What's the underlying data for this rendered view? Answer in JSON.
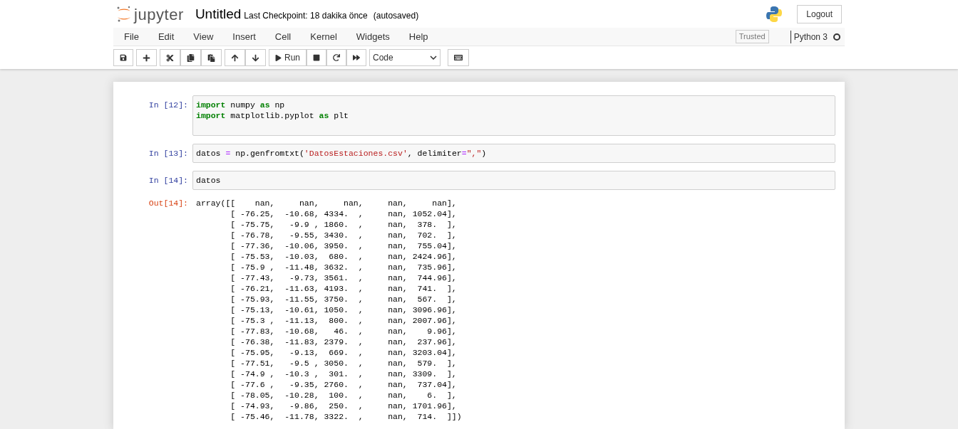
{
  "header": {
    "logo_text": "jupyter",
    "notebook_title": "Untitled",
    "checkpoint": "Last Checkpoint: 18 dakika önce",
    "autosave": "(autosaved)",
    "logout": "Logout"
  },
  "menu": [
    "File",
    "Edit",
    "View",
    "Insert",
    "Cell",
    "Kernel",
    "Widgets",
    "Help"
  ],
  "trusted": "Trusted",
  "kernel": {
    "name": "Python 3",
    "busy": false
  },
  "toolbar": {
    "run_label": "Run",
    "cell_type": "Code"
  },
  "cells": [
    {
      "prompt": "In [12]:",
      "kind": "input",
      "lines": [
        [
          {
            "text": "import",
            "kind": "keyword"
          },
          {
            "text": " numpy ",
            "kind": "name"
          },
          {
            "text": "as",
            "kind": "keyword"
          },
          {
            "text": " np",
            "kind": "name"
          }
        ],
        [
          {
            "text": "import",
            "kind": "keyword"
          },
          {
            "text": " matplotlib.pyplot ",
            "kind": "name"
          },
          {
            "text": "as",
            "kind": "keyword"
          },
          {
            "text": " plt",
            "kind": "name"
          }
        ]
      ]
    },
    {
      "prompt": "In [13]:",
      "kind": "input",
      "lines": [
        [
          {
            "text": "datos ",
            "kind": "name"
          },
          {
            "text": "=",
            "kind": "operator"
          },
          {
            "text": " np.genfromtxt(",
            "kind": "name"
          },
          {
            "text": "'DatosEstaciones.csv'",
            "kind": "string"
          },
          {
            "text": ", delimiter",
            "kind": "name"
          },
          {
            "text": "=",
            "kind": "operator"
          },
          {
            "text": "\",\"",
            "kind": "string"
          },
          {
            "text": ")",
            "kind": "name"
          }
        ]
      ]
    },
    {
      "prompt": "In [14]:",
      "kind": "input",
      "lines": [
        [
          {
            "text": "datos",
            "kind": "name"
          }
        ]
      ]
    },
    {
      "prompt": "Out[14]:",
      "kind": "output",
      "output_lines": [
        "array([[    nan,     nan,     nan,     nan,     nan],",
        "       [ -76.25,  -10.68, 4334.  ,     nan, 1052.04],",
        "       [ -75.75,   -9.9 , 1860.  ,     nan,  378.  ],",
        "       [ -76.78,   -9.55, 3430.  ,     nan,  702.  ],",
        "       [ -77.36,  -10.06, 3950.  ,     nan,  755.04],",
        "       [ -75.53,  -10.03,  680.  ,     nan, 2424.96],",
        "       [ -75.9 ,  -11.48, 3632.  ,     nan,  735.96],",
        "       [ -77.43,   -9.73, 3561.  ,     nan,  744.96],",
        "       [ -76.21,  -11.63, 4193.  ,     nan,  741.  ],",
        "       [ -75.93,  -11.55, 3750.  ,     nan,  567.  ],",
        "       [ -75.13,  -10.61, 1050.  ,     nan, 3096.96],",
        "       [ -75.3 ,  -11.13,  800.  ,     nan, 2007.96],",
        "       [ -77.83,  -10.68,   46.  ,     nan,    9.96],",
        "       [ -76.38,  -11.83, 2379.  ,     nan,  237.96],",
        "       [ -75.95,   -9.13,  669.  ,     nan, 3203.04],",
        "       [ -77.51,   -9.5 , 3050.  ,     nan,  579.  ],",
        "       [ -74.9 ,  -10.3 ,  301.  ,     nan, 3309.  ],",
        "       [ -77.6 ,   -9.35, 2760.  ,     nan,  737.04],",
        "       [ -78.05,  -10.28,  100.  ,     nan,    6.  ],",
        "       [ -74.93,   -9.86,  250.  ,     nan, 1701.96],",
        "       [ -75.46,  -11.78, 3322.  ,     nan,  714.  ]])"
      ]
    }
  ]
}
